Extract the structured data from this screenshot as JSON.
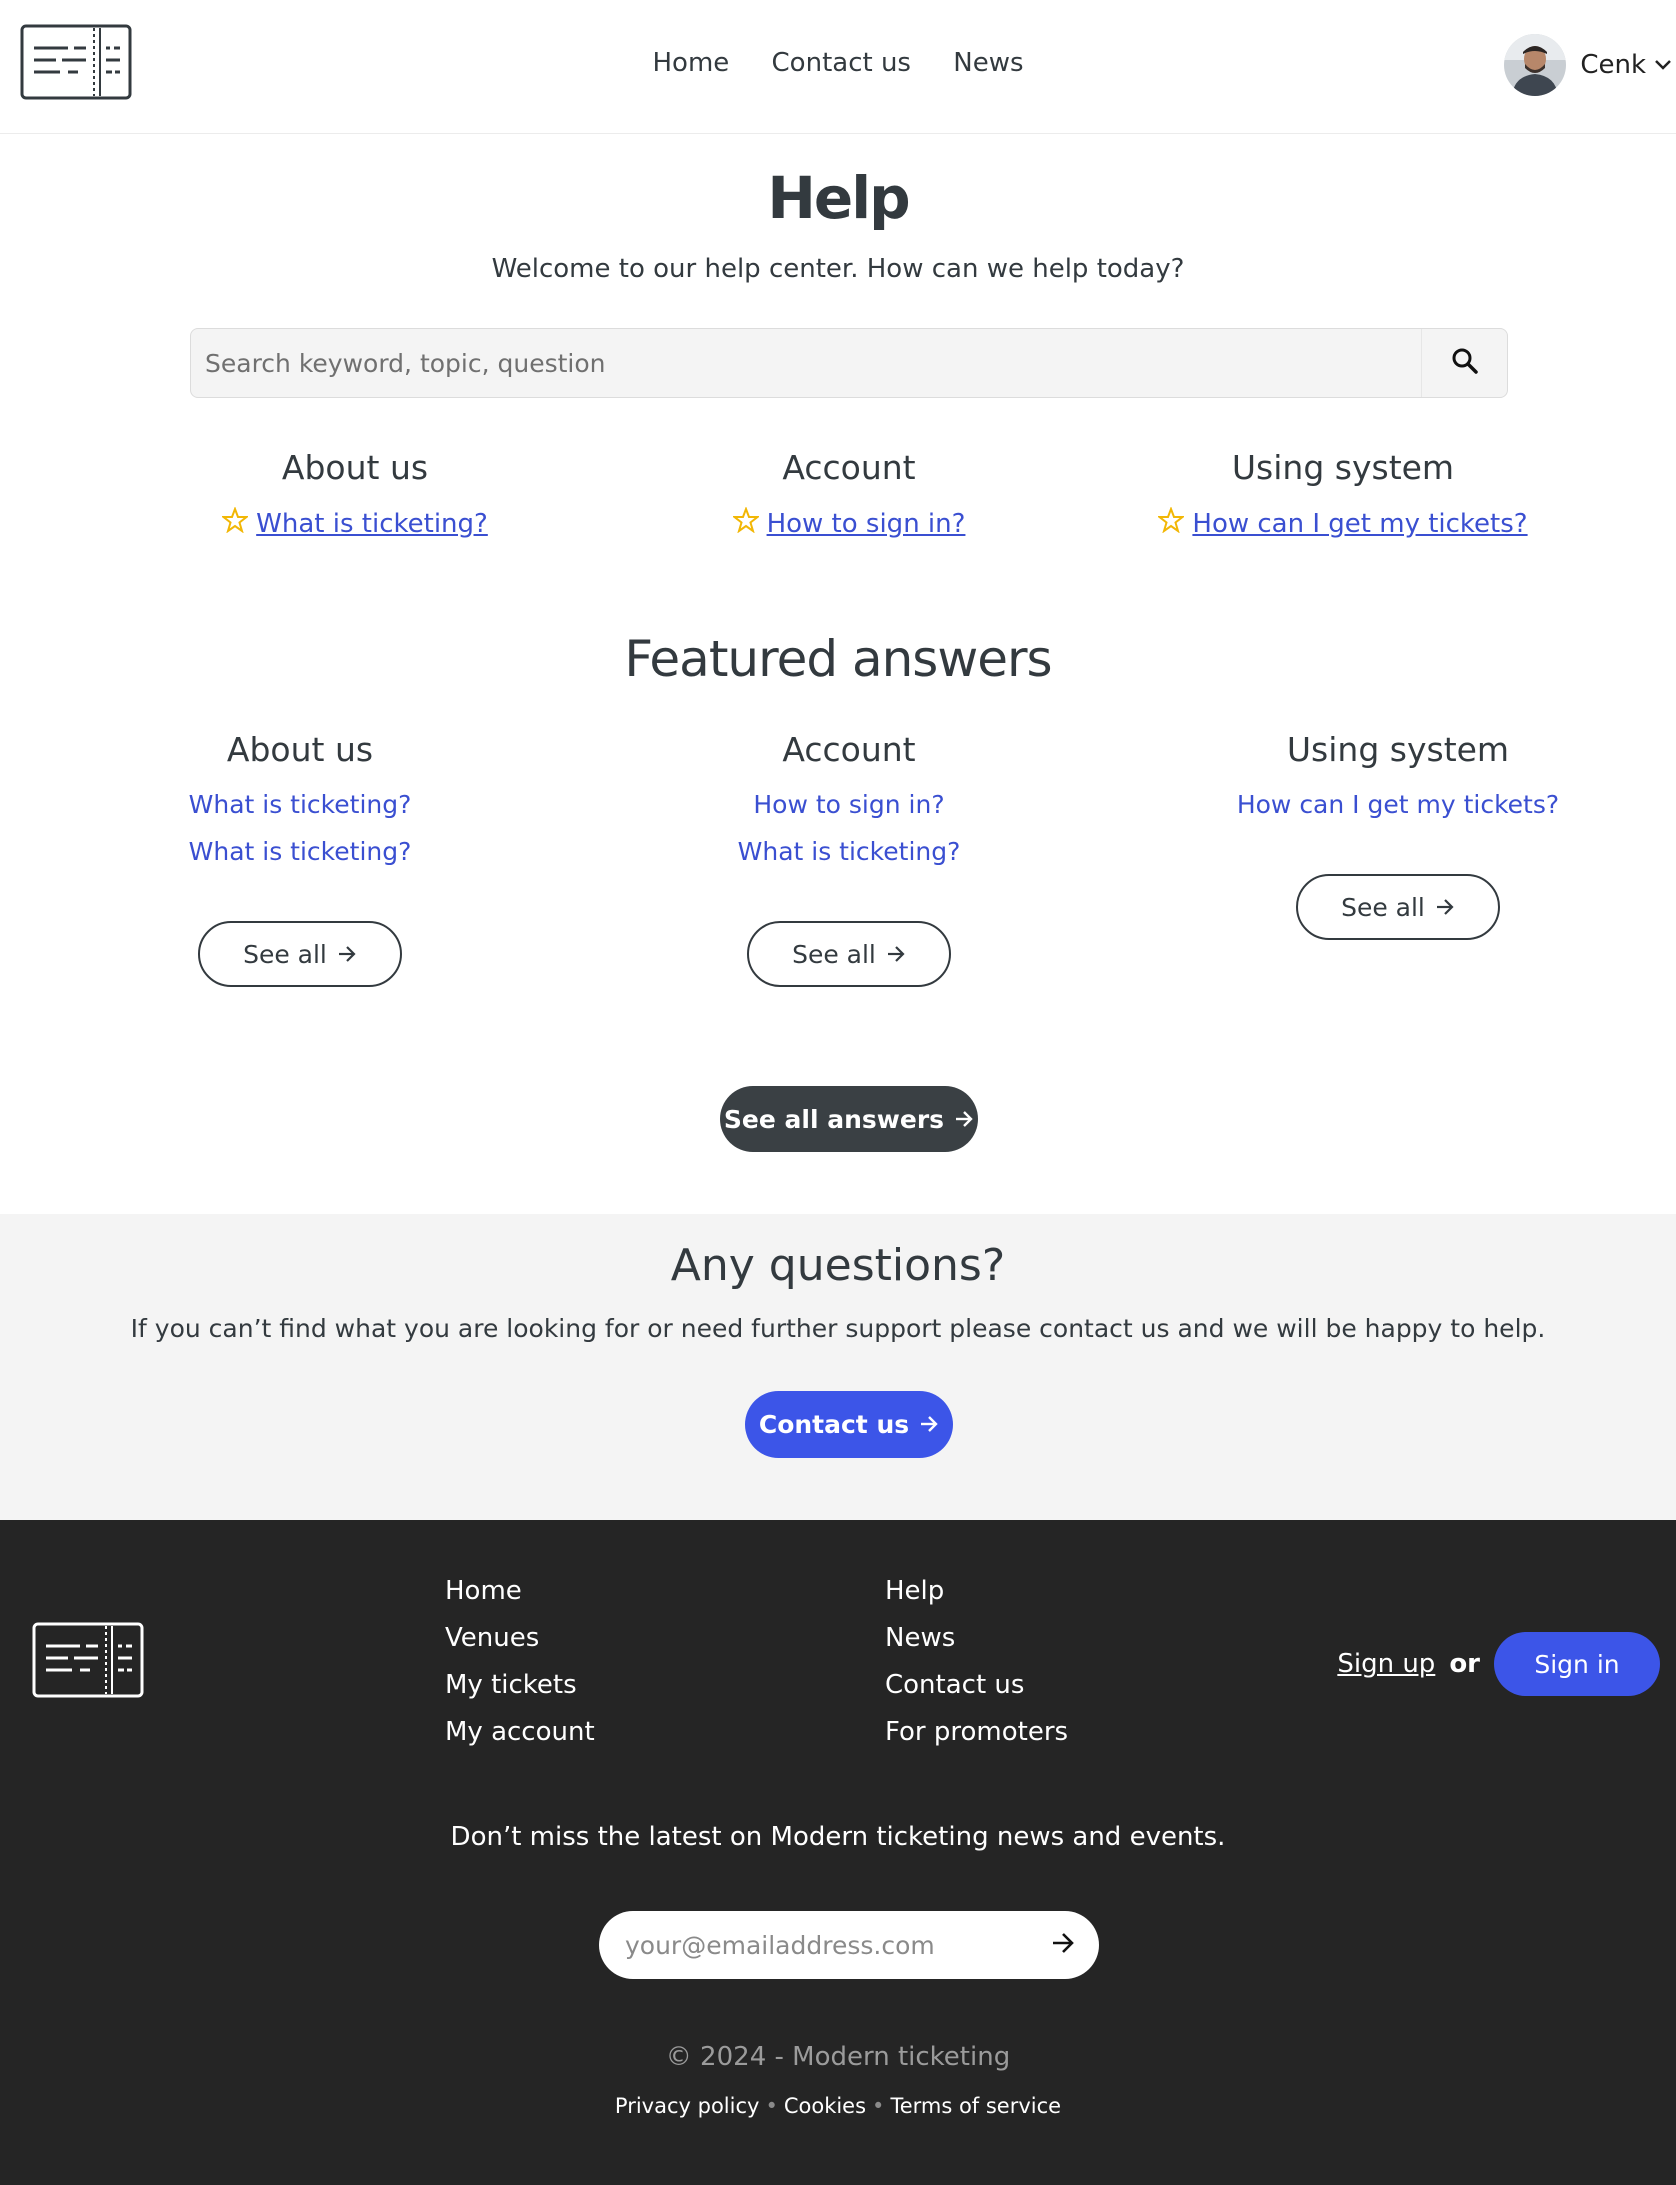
{
  "header": {
    "nav": [
      "Home",
      "Contact us",
      "News"
    ],
    "user_name": "Cenk"
  },
  "hero": {
    "title": "Help",
    "subtitle": "Welcome to our help center. How can we help today?",
    "search_placeholder": "Search keyword, topic, question"
  },
  "quick": [
    {
      "title": "About us",
      "link": "What is ticketing?"
    },
    {
      "title": "Account",
      "link": "How to sign in?"
    },
    {
      "title": "Using system",
      "link": "How can I get my tickets?"
    }
  ],
  "featured": {
    "title": "Featured answers",
    "columns": [
      {
        "title": "About us",
        "links": [
          "What is ticketing?",
          "What is ticketing?"
        ],
        "button": "See all"
      },
      {
        "title": "Account",
        "links": [
          "How to sign in?",
          "What is ticketing?"
        ],
        "button": "See all"
      },
      {
        "title": "Using system",
        "links": [
          "How can I get my tickets?"
        ],
        "button": "See all"
      }
    ],
    "see_all_answers": "See all answers"
  },
  "questions": {
    "title": "Any questions?",
    "text": "If you can’t find what you are looking for or need further support please contact us and we will be happy to help.",
    "button": "Contact us"
  },
  "footer": {
    "col1": [
      "Home",
      "Venues",
      "My tickets",
      "My account"
    ],
    "col2": [
      "Help",
      "News",
      "Contact us",
      "For promoters"
    ],
    "sign_up": "Sign up",
    "or": "or",
    "sign_in": "Sign in",
    "newsletter_text": "Don’t miss the latest on Modern ticketing news and events.",
    "email_placeholder": "your@emailaddress.com",
    "copyright": "© 2024 - Modern ticketing",
    "legal": [
      "Privacy policy",
      "Cookies",
      "Terms of service"
    ]
  },
  "colors": {
    "link": "#3a4fd1",
    "primary": "#3c55e8",
    "dark": "#3a4044",
    "footer_bg": "#252525",
    "star": "#f2b705"
  },
  "icons": [
    "logo-icon",
    "search-icon",
    "star-icon",
    "arrow-right-icon",
    "chevron-down-icon"
  ]
}
